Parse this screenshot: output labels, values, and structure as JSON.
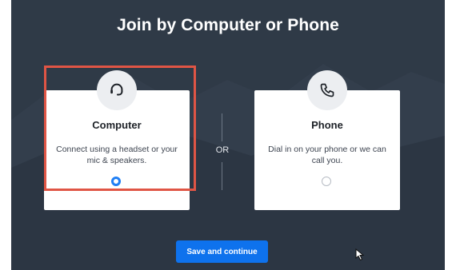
{
  "dialog": {
    "title": "Join by Computer or Phone",
    "separator": "OR",
    "save_label": "Save and continue"
  },
  "options": [
    {
      "title": "Computer",
      "description": "Connect using a headset or your mic & speakers.",
      "icon": "headset-icon",
      "selected": true
    },
    {
      "title": "Phone",
      "description": "Dial in on your phone or we can call you.",
      "icon": "phone-icon",
      "selected": false
    }
  ],
  "colors": {
    "background": "#2f3a47",
    "accent": "#0e72ed",
    "highlight": "#e05545"
  }
}
